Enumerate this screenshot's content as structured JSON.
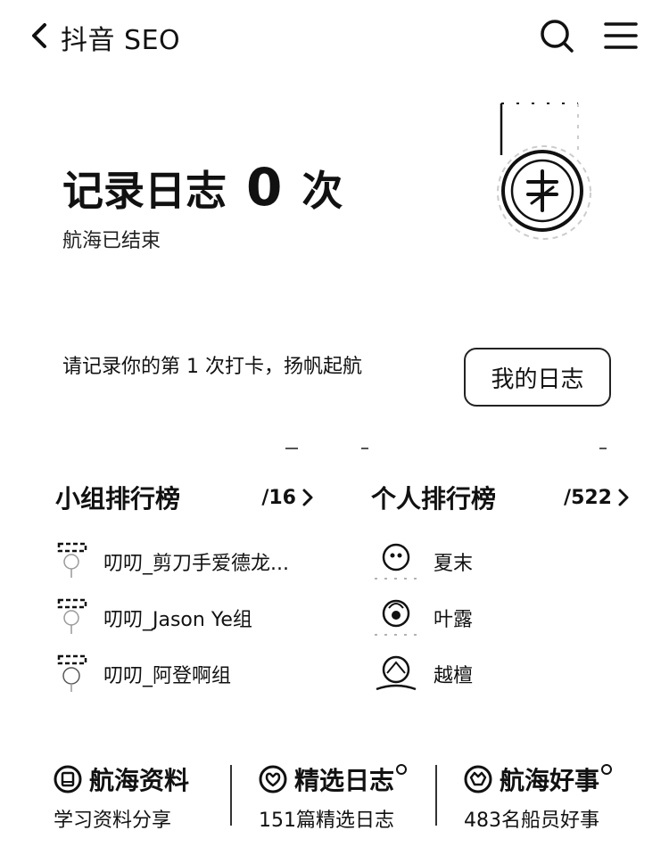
{
  "header": {
    "title": "抖音 SEO",
    "back_icon": "chevron-left-icon",
    "search_icon": "search-icon",
    "menu_icon": "menu-icon"
  },
  "hero": {
    "title_prefix": "记录日志",
    "count": "0",
    "title_suffix": "次",
    "subtitle": "航海已结束",
    "medal_icon": "medal-icon"
  },
  "prompt": {
    "text": "请记录你的第 1 次打卡，扬帆起航",
    "button_label": "我的日志"
  },
  "group_rank": {
    "title": "小组排行榜",
    "more": "/16",
    "items": [
      {
        "name": "叨叨_剪刀手爱德龙..."
      },
      {
        "name": "叨叨_Jason Ye组"
      },
      {
        "name": "叨叨_阿登啊组"
      }
    ]
  },
  "personal_rank": {
    "title": "个人排行榜",
    "more": "/522",
    "items": [
      {
        "name": "夏末"
      },
      {
        "name": "叶露"
      },
      {
        "name": "越檀"
      }
    ]
  },
  "features": [
    {
      "title": "航海资料",
      "subtitle": "学习资料分享",
      "icon": "book-icon",
      "dot": false
    },
    {
      "title": "精选日志",
      "subtitle": "151篇精选日志",
      "icon": "heart-icon",
      "dot": true
    },
    {
      "title": "航海好事",
      "subtitle": "483名船员好事",
      "icon": "smile-icon",
      "dot": true
    }
  ]
}
